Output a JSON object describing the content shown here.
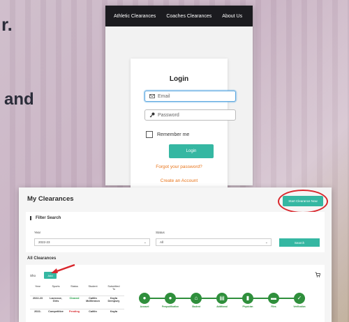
{
  "background": {
    "dot_text": "r.",
    "and_text": "and"
  },
  "login_page": {
    "nav": [
      "Athletic Clearances",
      "Coaches Clearances",
      "About Us"
    ],
    "title": "Login",
    "email_placeholder": "Email",
    "password_placeholder": "Password",
    "remember_label": "Remember me",
    "login_button": "Login",
    "forgot_link": "Forgot your password?",
    "create_link": "Create an Account"
  },
  "clearances_page": {
    "title": "My Clearances",
    "start_button": "Start Clearance Now",
    "filter": {
      "title": "Filter Search",
      "year_label": "Year",
      "year_value": "2022-23",
      "status_label": "Status",
      "status_value": "All",
      "search_button": "Search"
    },
    "all_title": "All Clearances",
    "show_label": "Sho",
    "add_button": "Add",
    "table": {
      "headers": [
        "Year",
        "Sports",
        "Status",
        "Student",
        "Submitted To"
      ],
      "rows": [
        [
          "2022-23",
          "Lacrosse, Girls",
          "Cleared",
          "Caitlin McMennon",
          "Kayla Dempsey"
        ],
        [
          "2022-",
          "Competitive",
          "Pending",
          "Caitlin",
          "Kayla"
        ]
      ]
    },
    "steps": [
      "Account",
      "Prequalification",
      "Student",
      "Additional",
      "Physician",
      "Files",
      "Verification"
    ]
  },
  "colors": {
    "accent": "#35b7a2",
    "highlight": "#d9262c",
    "step_green": "#2f8f3c",
    "cleared": "#1a9a3e",
    "pending": "#d6282d",
    "link": "#e8741a"
  }
}
